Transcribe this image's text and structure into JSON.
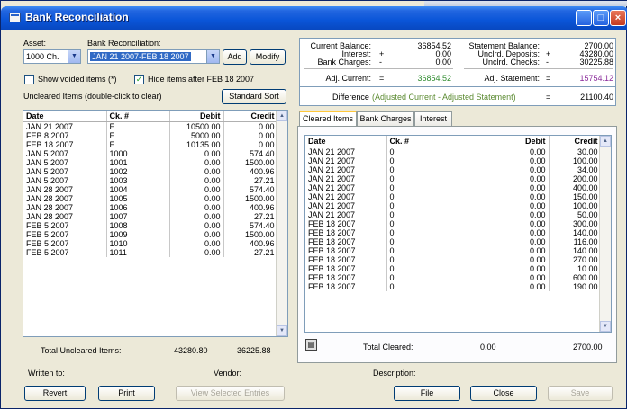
{
  "window": {
    "title": "Bank Reconciliation"
  },
  "controls": {
    "asset_label": "Asset:",
    "asset_value": "1000 Ch.",
    "bank_rec_label": "Bank Reconciliation:",
    "bank_rec_value": "JAN 21 2007-FEB 18 2007",
    "add_label": "Add",
    "modify_label": "Modify",
    "show_voided_label": "Show voided items (*)",
    "show_voided_checked": false,
    "hide_items_label": "Hide items after FEB 18 2007",
    "hide_items_checked": true,
    "uncleared_hint": "Uncleared Items (double-click to clear)",
    "standard_sort_label": "Standard Sort"
  },
  "uncleared": {
    "columns": [
      "Date",
      "Ck. #",
      "Debit",
      "Credit"
    ],
    "rows": [
      [
        "JAN 21 2007",
        "E",
        "10500.00",
        "0.00"
      ],
      [
        "FEB 8 2007",
        "E",
        "5000.00",
        "0.00"
      ],
      [
        "FEB 18 2007",
        "E",
        "10135.00",
        "0.00"
      ],
      [
        "JAN 5 2007",
        "1000",
        "0.00",
        "574.40"
      ],
      [
        "JAN 5 2007",
        "1001",
        "0.00",
        "1500.00"
      ],
      [
        "JAN 5 2007",
        "1002",
        "0.00",
        "400.96"
      ],
      [
        "JAN 5 2007",
        "1003",
        "0.00",
        "27.21"
      ],
      [
        "JAN 28 2007",
        "1004",
        "0.00",
        "574.40"
      ],
      [
        "JAN 28 2007",
        "1005",
        "0.00",
        "1500.00"
      ],
      [
        "JAN 28 2007",
        "1006",
        "0.00",
        "400.96"
      ],
      [
        "JAN 28 2007",
        "1007",
        "0.00",
        "27.21"
      ],
      [
        "FEB 5 2007",
        "1008",
        "0.00",
        "574.40"
      ],
      [
        "FEB 5 2007",
        "1009",
        "0.00",
        "1500.00"
      ],
      [
        "FEB 5 2007",
        "1010",
        "0.00",
        "400.96"
      ],
      [
        "FEB 5 2007",
        "1011",
        "0.00",
        "27.21"
      ]
    ],
    "total_label": "Total Uncleared Items:",
    "total_debit": "43280.80",
    "total_credit": "36225.88"
  },
  "summary": {
    "current_balance_label": "Current Balance:",
    "current_balance": "36854.52",
    "interest_label": "Interest:",
    "interest_sign": "+",
    "interest": "0.00",
    "bank_charges_label": "Bank Charges:",
    "bank_charges_sign": "-",
    "bank_charges": "0.00",
    "adj_current_label": "Adj. Current:",
    "adj_current_sign": "=",
    "adj_current": "36854.52",
    "statement_balance_label": "Statement Balance:",
    "statement_balance": "2700.00",
    "unclrd_deposits_label": "Unclrd. Deposits:",
    "unclrd_deposits_sign": "+",
    "unclrd_deposits": "43280.00",
    "unclrd_checks_label": "Unclrd. Checks:",
    "unclrd_checks_sign": "-",
    "unclrd_checks": "30225.88",
    "adj_statement_label": "Adj. Statement:",
    "adj_statement_sign": "=",
    "adj_statement": "15754.12",
    "difference_label": "Difference",
    "difference_formula": "(Adjusted Current - Adjusted Statement)",
    "difference_sign": "=",
    "difference": "21100.40",
    "colors": {
      "adj_current": "#2e8b2e",
      "adj_statement": "#8a2a9a",
      "difference_formula": "#5a8a30"
    }
  },
  "tabs": [
    "Cleared Items",
    "Bank Charges",
    "Interest"
  ],
  "cleared": {
    "columns": [
      "Date",
      "Ck. #",
      "Debit",
      "Credit"
    ],
    "rows": [
      [
        "JAN 21 2007",
        "0",
        "0.00",
        "30.00"
      ],
      [
        "JAN 21 2007",
        "0",
        "0.00",
        "100.00"
      ],
      [
        "JAN 21 2007",
        "0",
        "0.00",
        "34.00"
      ],
      [
        "JAN 21 2007",
        "0",
        "0.00",
        "200.00"
      ],
      [
        "JAN 21 2007",
        "0",
        "0.00",
        "400.00"
      ],
      [
        "JAN 21 2007",
        "0",
        "0.00",
        "150.00"
      ],
      [
        "JAN 21 2007",
        "0",
        "0.00",
        "100.00"
      ],
      [
        "JAN 21 2007",
        "0",
        "0.00",
        "50.00"
      ],
      [
        "FEB 18 2007",
        "0",
        "0.00",
        "300.00"
      ],
      [
        "FEB 18 2007",
        "0",
        "0.00",
        "140.00"
      ],
      [
        "FEB 18 2007",
        "0",
        "0.00",
        "116.00"
      ],
      [
        "FEB 18 2007",
        "0",
        "0.00",
        "140.00"
      ],
      [
        "FEB 18 2007",
        "0",
        "0.00",
        "270.00"
      ],
      [
        "FEB 18 2007",
        "0",
        "0.00",
        "10.00"
      ],
      [
        "FEB 18 2007",
        "0",
        "0.00",
        "600.00"
      ],
      [
        "FEB 18 2007",
        "0",
        "0.00",
        "190.00"
      ]
    ],
    "total_label": "Total Cleared:",
    "total_debit": "0.00",
    "total_credit": "2700.00"
  },
  "footer": {
    "written_to_label": "Written to:",
    "vendor_label": "Vendor:",
    "description_label": "Description:",
    "revert_label": "Revert",
    "print_label": "Print",
    "view_selected_label": "View Selected Entries",
    "file_label": "File",
    "close_label": "Close",
    "save_label": "Save"
  }
}
